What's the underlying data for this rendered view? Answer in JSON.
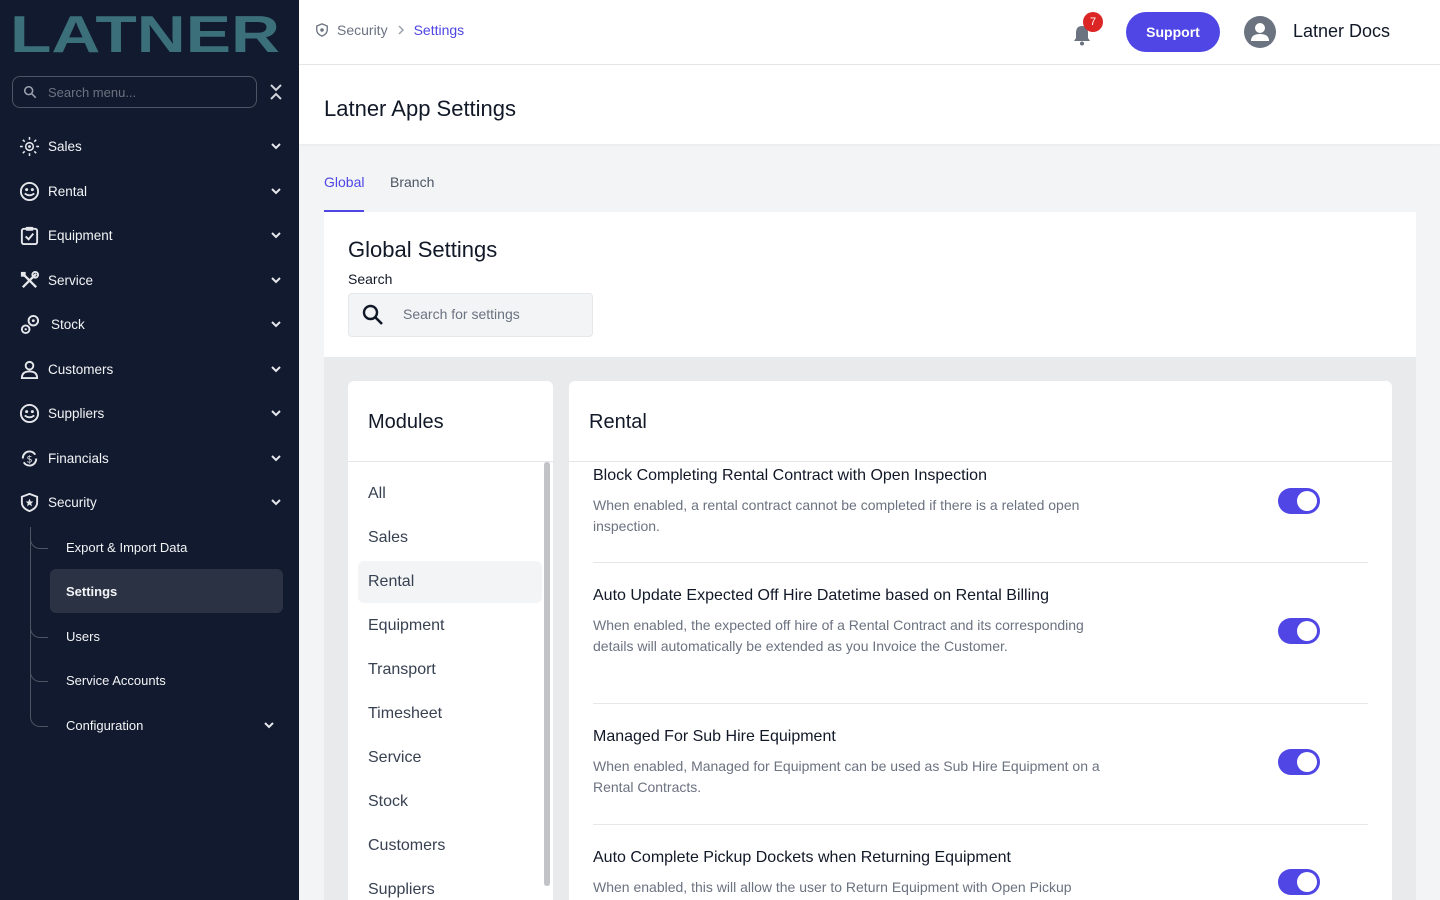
{
  "sidebar": {
    "logo_text": "LATNER",
    "search_placeholder": "Search menu...",
    "items": [
      {
        "label": "Sales"
      },
      {
        "label": "Rental"
      },
      {
        "label": "Equipment"
      },
      {
        "label": "Service"
      },
      {
        "label": "Stock"
      },
      {
        "label": "Customers"
      },
      {
        "label": "Suppliers"
      },
      {
        "label": "Financials"
      },
      {
        "label": "Security"
      }
    ],
    "security_children": [
      {
        "label": "Export & Import Data"
      },
      {
        "label": "Settings"
      },
      {
        "label": "Users"
      },
      {
        "label": "Service Accounts"
      },
      {
        "label": "Configuration"
      }
    ]
  },
  "header": {
    "breadcrumb": {
      "parent": "Security",
      "current": "Settings"
    },
    "notification_count": "7",
    "support_label": "Support",
    "user_name": "Latner Docs"
  },
  "page": {
    "title": "Latner App Settings",
    "tabs": [
      {
        "label": "Global"
      },
      {
        "label": "Branch"
      }
    ]
  },
  "global_settings": {
    "title": "Global Settings",
    "search_label": "Search",
    "search_placeholder": "Search for settings"
  },
  "modules": {
    "title": "Modules",
    "items": [
      "All",
      "Sales",
      "Rental",
      "Equipment",
      "Transport",
      "Timesheet",
      "Service",
      "Stock",
      "Customers",
      "Suppliers"
    ]
  },
  "rental": {
    "title": "Rental",
    "settings": [
      {
        "title": "Block Completing Rental Contract with Open Inspection",
        "description": "When enabled, a rental contract cannot be completed if there is a related open inspection.",
        "enabled": true
      },
      {
        "title": "Auto Update Expected Off Hire Datetime based on Rental Billing",
        "description": "When enabled, the expected off hire of a Rental Contract and its corresponding details will automatically be extended as you Invoice the Customer.",
        "enabled": true
      },
      {
        "title": "Managed For Sub Hire Equipment",
        "description": "When enabled, Managed for Equipment can be used as Sub Hire Equipment on a Rental Contracts.",
        "enabled": true
      },
      {
        "title": "Auto Complete Pickup Dockets when Returning Equipment",
        "description": "When enabled, this will allow the user to Return Equipment with Open Pickup",
        "enabled": true
      }
    ]
  },
  "colors": {
    "sidebar_bg": "#111a2e",
    "accent": "#4f46e5",
    "logo": "#3b6f79",
    "badge": "#dc2626"
  }
}
